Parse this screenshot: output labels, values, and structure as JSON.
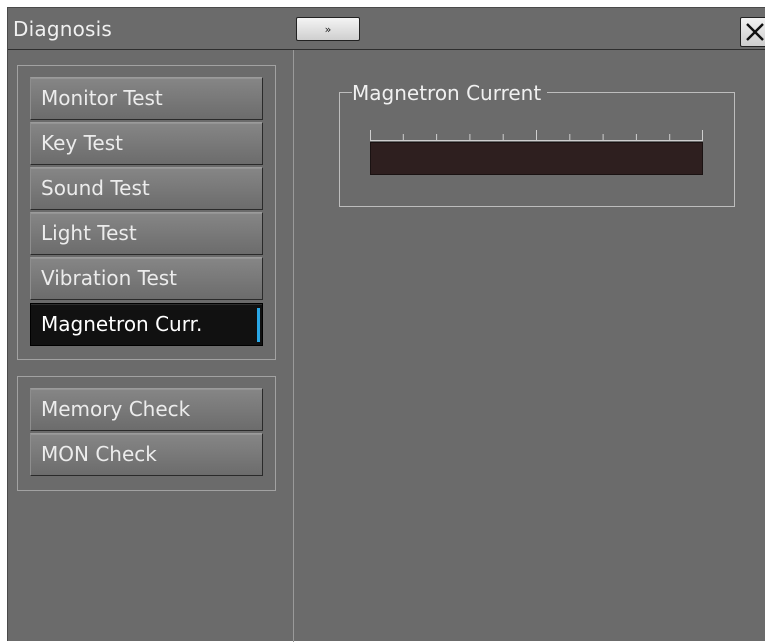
{
  "window": {
    "title": "Diagnosis",
    "expand_icon": "double-chevron-right-icon",
    "expand_glyph": "»",
    "close_icon": "close-icon"
  },
  "sidebar": {
    "test_group": [
      {
        "label": "Monitor Test",
        "active": false
      },
      {
        "label": "Key Test",
        "active": false
      },
      {
        "label": "Sound Test",
        "active": false
      },
      {
        "label": "Light Test",
        "active": false
      },
      {
        "label": "Vibration Test",
        "active": false
      },
      {
        "label": "Magnetron Curr.",
        "active": true
      }
    ],
    "check_group": [
      {
        "label": "Memory Check"
      },
      {
        "label": "MON Check"
      }
    ]
  },
  "main": {
    "magnetron": {
      "title": "Magnetron Current",
      "level": 0,
      "scale_divisions": 10
    }
  },
  "colors": {
    "panel_bg": "#6b6b6b",
    "active_button_bg": "#111111",
    "active_marker": "#2aa7e6",
    "meter_bg": "#2e1f1f"
  }
}
